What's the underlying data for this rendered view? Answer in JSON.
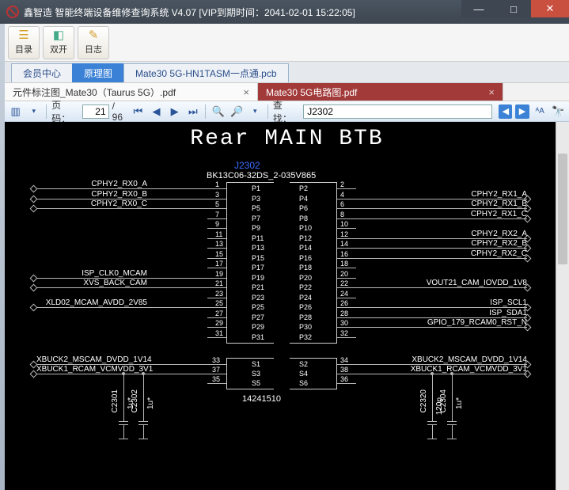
{
  "window": {
    "title": "鑫智造 智能终端设备维修查询系统 V4.07 [VIP到期时间：2041-02-01 15:22:05]"
  },
  "toolbar": {
    "btn1": "目录",
    "btn2": "双开",
    "btn3": "日志"
  },
  "tabs1": {
    "t1": "会员中心",
    "t2": "原理图",
    "t3": "Mate30 5G-HN1TASM一点通.pcb"
  },
  "tabs2": {
    "inactive": "元件标注图_Mate30（Taurus 5G）.pdf",
    "active": "Mate30 5G电路图.pdf"
  },
  "pdfbar": {
    "page_label": "页码：",
    "page_value": "21",
    "page_total": "/ 96",
    "find_label": "查找：",
    "find_value": "J2302"
  },
  "schematic": {
    "title": "Rear MAIN BTB",
    "ref": "J2302",
    "part": "BK13C06-32DS_2-035V865",
    "footprint": "14241510",
    "left_nets": [
      "CPHY2_RX0_A",
      "CPHY2_RX0_B",
      "CPHY2_RX0_C",
      "",
      "",
      "ISP_CLK0_MCAM",
      "XVS_BACK_CAM",
      "XLD02_MCAM_AVDD_2V85",
      "",
      "XBUCK2_MSCAM_DVDD_1V14",
      "XBUCK1_RCAM_VCMVDD_3V1"
    ],
    "right_nets": [
      "CPHY2_RX1_A",
      "CPHY2_RX1_B",
      "CPHY2_RX1_C",
      "CPHY2_RX2_A",
      "CPHY2_RX2_B",
      "CPHY2_RX2_C",
      "",
      "VOUT21_CAM_IOVDD_1V8",
      "ISP_SCL1",
      "ISP_SDA1",
      "GPIO_179_RCAM0_RST_N",
      "",
      "XBUCK2_MSCAM_DVDD_1V14",
      "XBUCK1_RCAM_VCMVDD_3V1"
    ],
    "left_pins": [
      {
        "n": "P1",
        "num": "1"
      },
      {
        "n": "P3",
        "num": "3"
      },
      {
        "n": "P5",
        "num": "5"
      },
      {
        "n": "P7",
        "num": "7"
      },
      {
        "n": "P9",
        "num": "9"
      },
      {
        "n": "P11",
        "num": "11"
      },
      {
        "n": "P13",
        "num": "13"
      },
      {
        "n": "P15",
        "num": "15"
      },
      {
        "n": "P17",
        "num": "17"
      },
      {
        "n": "P19",
        "num": "19"
      },
      {
        "n": "P21",
        "num": "21"
      },
      {
        "n": "P23",
        "num": "23"
      },
      {
        "n": "P25",
        "num": "25"
      },
      {
        "n": "P27",
        "num": "27"
      },
      {
        "n": "P29",
        "num": "29"
      },
      {
        "n": "P31",
        "num": "31"
      }
    ],
    "right_pins": [
      {
        "n": "P2",
        "num": "2"
      },
      {
        "n": "P4",
        "num": "4"
      },
      {
        "n": "P6",
        "num": "6"
      },
      {
        "n": "P8",
        "num": "8"
      },
      {
        "n": "P10",
        "num": "10"
      },
      {
        "n": "P12",
        "num": "12"
      },
      {
        "n": "P14",
        "num": "14"
      },
      {
        "n": "P16",
        "num": "16"
      },
      {
        "n": "P18",
        "num": "18"
      },
      {
        "n": "P20",
        "num": "20"
      },
      {
        "n": "P22",
        "num": "22"
      },
      {
        "n": "P24",
        "num": "24"
      },
      {
        "n": "P26",
        "num": "26"
      },
      {
        "n": "P28",
        "num": "28"
      },
      {
        "n": "P30",
        "num": "30"
      },
      {
        "n": "P32",
        "num": "32"
      }
    ],
    "shield_left": [
      {
        "n": "S1",
        "num": "33"
      },
      {
        "n": "S3",
        "num": "37"
      },
      {
        "n": "S5",
        "num": "35"
      }
    ],
    "shield_right": [
      {
        "n": "S2",
        "num": "34"
      },
      {
        "n": "S4",
        "num": "38"
      },
      {
        "n": "S6",
        "num": "36"
      }
    ],
    "caps_left": [
      {
        "ref": "C2301",
        "val": "1u*"
      },
      {
        "ref": "C2302",
        "val": "1u*"
      }
    ],
    "caps_right": [
      {
        "ref": "C2320",
        "val": "120p"
      },
      {
        "ref": "C2304",
        "val": "1u*"
      }
    ]
  }
}
